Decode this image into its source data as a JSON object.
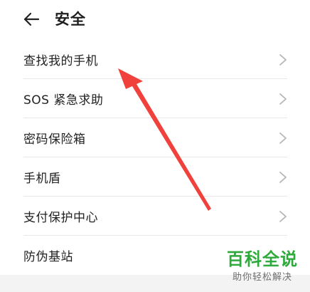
{
  "header": {
    "back_icon": "arrow-left-icon",
    "title": "安全"
  },
  "list": {
    "items": [
      {
        "label": "查找我的手机",
        "icon": "chevron-right-icon"
      },
      {
        "label": "SOS 紧急求助",
        "icon": "chevron-right-icon"
      },
      {
        "label": "密码保险箱",
        "icon": "chevron-right-icon"
      },
      {
        "label": "手机盾",
        "icon": "chevron-right-icon"
      },
      {
        "label": "支付保护中心",
        "icon": "chevron-right-icon"
      },
      {
        "label": "防伪基站",
        "icon": ""
      }
    ]
  },
  "annotation": {
    "color": "#f0413c"
  },
  "watermark": {
    "brand": "百科全说",
    "tagline": "助你轻松解决",
    "color": "#2eaa3c"
  }
}
